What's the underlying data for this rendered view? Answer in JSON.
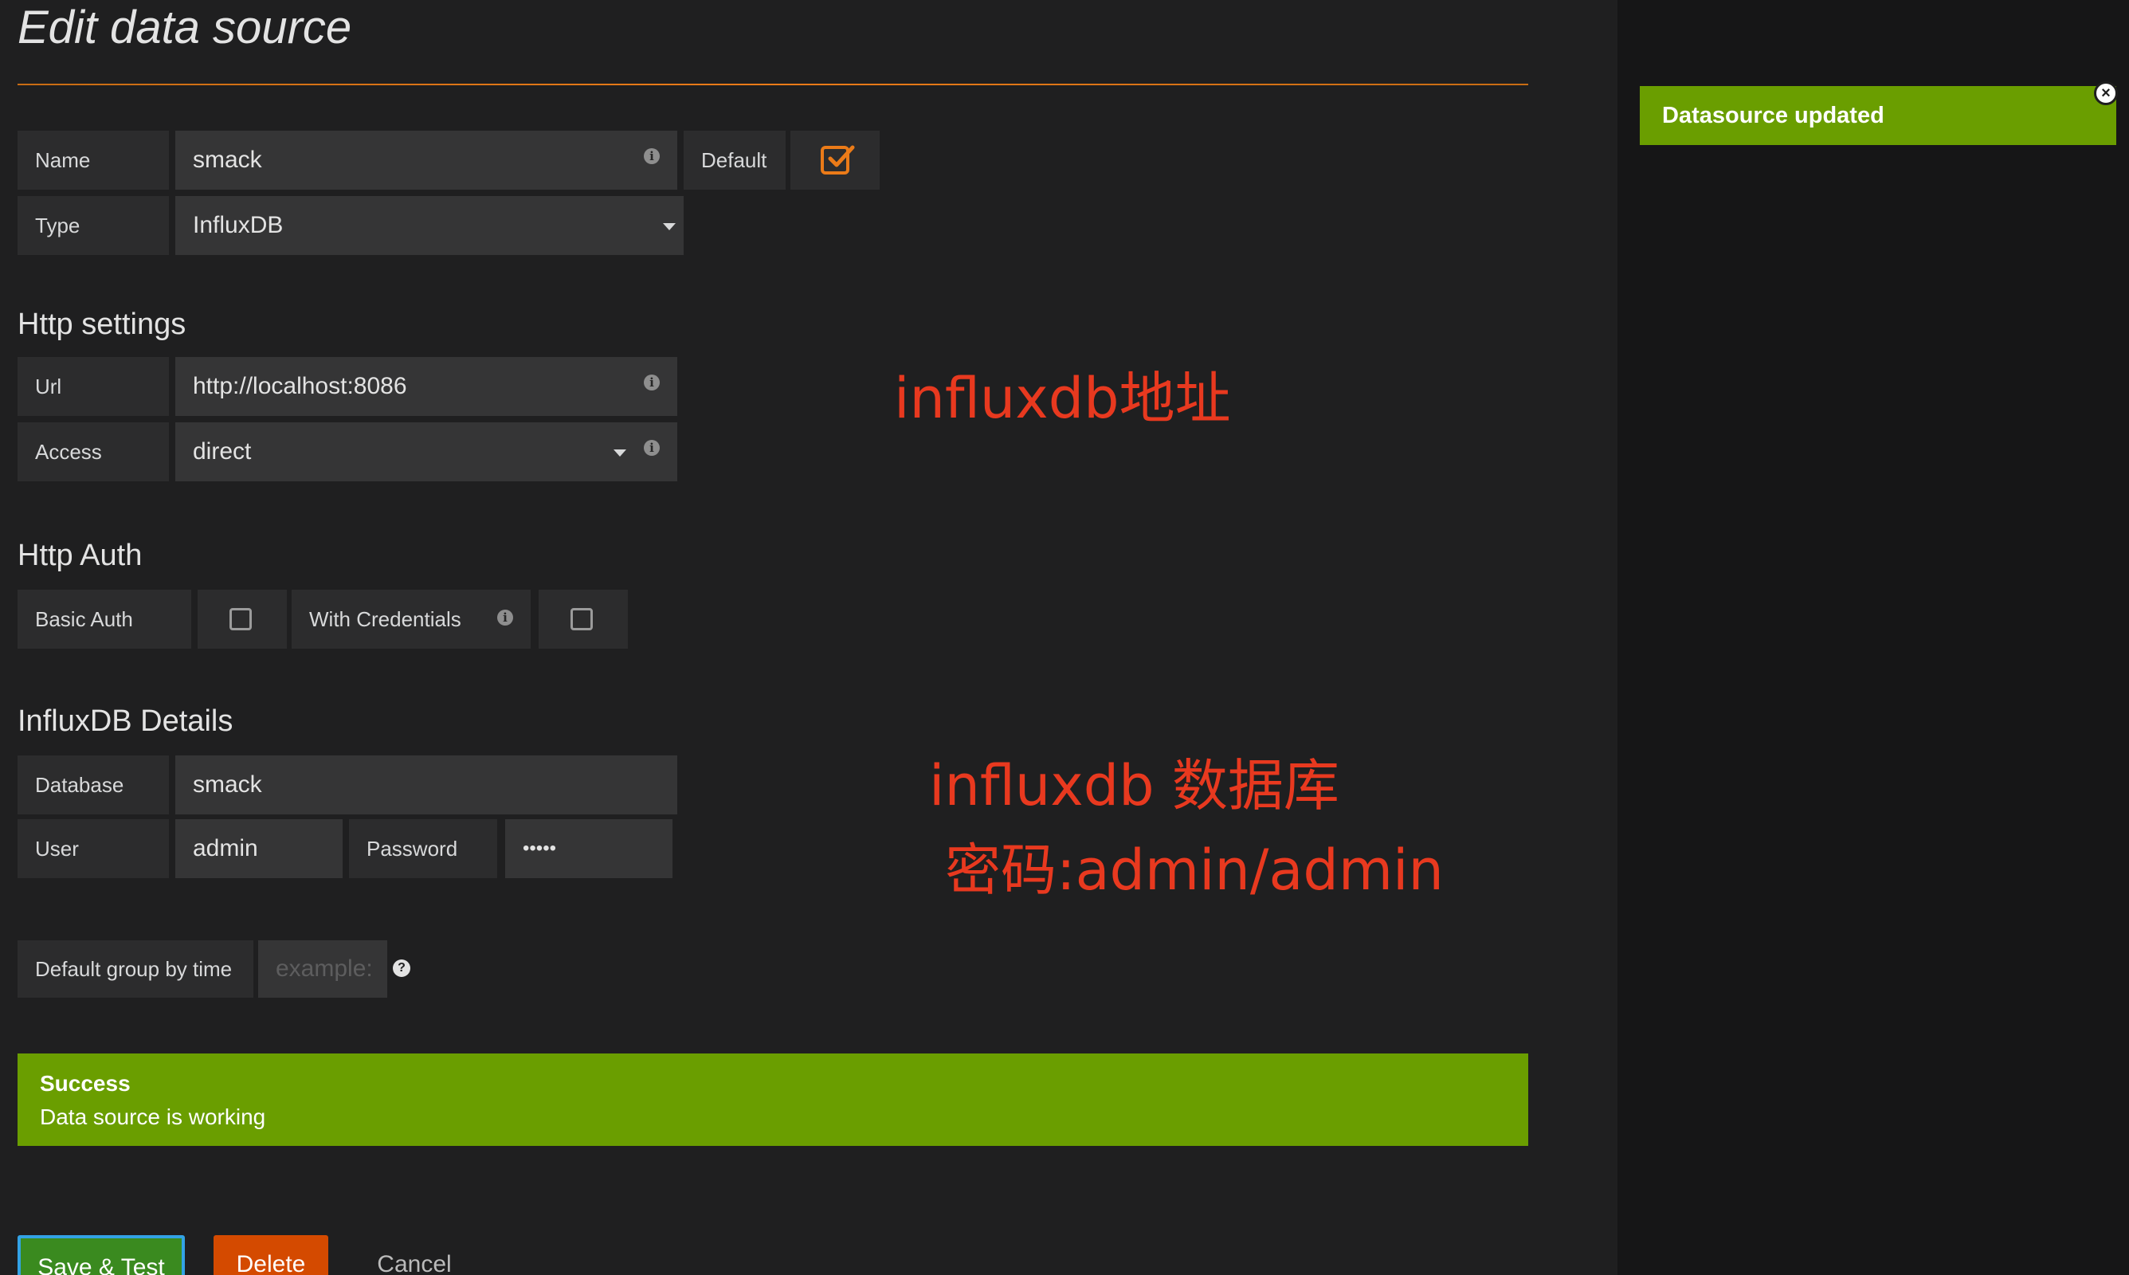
{
  "page": {
    "title": "Edit data source"
  },
  "basic": {
    "name_label": "Name",
    "name_value": "smack",
    "default_label": "Default",
    "default_checked": true,
    "type_label": "Type",
    "type_value": "InfluxDB"
  },
  "http_settings": {
    "heading": "Http settings",
    "url_label": "Url",
    "url_value": "http://localhost:8086",
    "access_label": "Access",
    "access_value": "direct"
  },
  "http_auth": {
    "heading": "Http Auth",
    "basic_auth_label": "Basic Auth",
    "basic_auth_checked": false,
    "with_credentials_label": "With Credentials",
    "with_credentials_checked": false
  },
  "influx_details": {
    "heading": "InfluxDB Details",
    "database_label": "Database",
    "database_value": "smack",
    "user_label": "User",
    "user_value": "admin",
    "password_label": "Password",
    "password_value": "•••••"
  },
  "group_by": {
    "label": "Default group by time",
    "placeholder": "example:"
  },
  "alert": {
    "title": "Success",
    "text": "Data source is working"
  },
  "toast": {
    "text": "Datasource updated",
    "close_glyph": "×"
  },
  "buttons": {
    "save": "Save & Test",
    "delete": "Delete",
    "cancel": "Cancel"
  },
  "annotations": {
    "url_note": "influxdb地址",
    "db_note": "influxdb 数据库",
    "cred_note": "密码:admin/admin"
  },
  "icons": {
    "info_glyph": "i",
    "help_glyph": "?"
  },
  "colors": {
    "accent_orange": "#eb7b18",
    "success_green": "#6a9e00",
    "delete_red": "#d44a00",
    "annotation_red": "#e8391f"
  }
}
